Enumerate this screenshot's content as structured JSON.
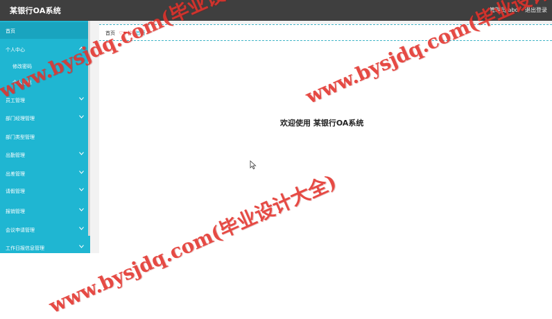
{
  "header": {
    "app_title": "某银行OA系统",
    "user_info": "管理员 abo",
    "logout_label": "退出登录"
  },
  "sidebar": {
    "items": [
      {
        "label": "首页",
        "chevron": ""
      },
      {
        "label": "个人中心",
        "chevron": "^"
      },
      {
        "label": "修改密码",
        "chevron": ""
      },
      {
        "label": "个人信息",
        "chevron": ""
      },
      {
        "label": "员工管理",
        "chevron": "v"
      },
      {
        "label": "部门经理管理",
        "chevron": "v"
      },
      {
        "label": "部门类型管理",
        "chevron": ""
      },
      {
        "label": "出勤管理",
        "chevron": "v"
      },
      {
        "label": "出差管理",
        "chevron": "v"
      },
      {
        "label": "请假管理",
        "chevron": "v"
      },
      {
        "label": "报销管理",
        "chevron": "v"
      },
      {
        "label": "会议申请管理",
        "chevron": "v"
      },
      {
        "label": "工作日报信息管理",
        "chevron": "v"
      }
    ]
  },
  "breadcrumb": {
    "home": "首页",
    "separator": "♡❤谷",
    "current": "首页"
  },
  "main": {
    "welcome_text": "欢迎使用 某银行OA系统"
  },
  "watermarks": [
    "www.bysjdq.com(毕业设计大全)",
    "www.bysjdq.com(毕业设计大全)",
    "www.bysjdq.com(毕业设计大全)"
  ],
  "colors": {
    "topbar": "#3f3f3f",
    "sidebar": "#1fb6d2",
    "accent": "#1fb6d2",
    "watermark": "#e3322b"
  }
}
